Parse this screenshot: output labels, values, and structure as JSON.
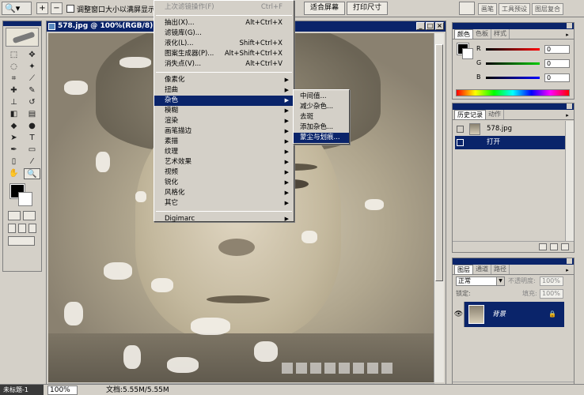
{
  "options_bar": {
    "tool_icon": "zoom-icon",
    "zoom_in": "+",
    "zoom_out": "−",
    "fit_check_label": "调整窗口大小以满屏显示",
    "fit_screen_label": "适合屏幕",
    "print_size_label": "打印尺寸",
    "tabs": [
      "画笔",
      "工具预设",
      "图层复合"
    ]
  },
  "document": {
    "title": "578.jpg @ 100%(RGB/8)",
    "min": "_",
    "max": "□",
    "close": "×"
  },
  "filter_menu": {
    "items": [
      {
        "label": "上次滤镜操作(F)",
        "shortcut": "Ctrl+F",
        "disabled": true
      },
      {
        "sep": true
      },
      {
        "label": "抽出(X)...",
        "shortcut": "Alt+Ctrl+X"
      },
      {
        "label": "滤镜库(G)..."
      },
      {
        "label": "液化(L)...",
        "shortcut": "Shift+Ctrl+X"
      },
      {
        "label": "图案生成器(P)...",
        "shortcut": "Alt+Shift+Ctrl+X"
      },
      {
        "label": "消失点(V)...",
        "shortcut": "Alt+Ctrl+V"
      },
      {
        "sep": true
      },
      {
        "label": "像素化",
        "sub": true
      },
      {
        "label": "扭曲",
        "sub": true
      },
      {
        "label": "杂色",
        "sub": true,
        "highlight": true
      },
      {
        "label": "模糊",
        "sub": true
      },
      {
        "label": "渲染",
        "sub": true
      },
      {
        "label": "画笔描边",
        "sub": true
      },
      {
        "label": "素描",
        "sub": true
      },
      {
        "label": "纹理",
        "sub": true
      },
      {
        "label": "艺术效果",
        "sub": true
      },
      {
        "label": "视频",
        "sub": true
      },
      {
        "label": "锐化",
        "sub": true
      },
      {
        "label": "风格化",
        "sub": true
      },
      {
        "label": "其它",
        "sub": true
      },
      {
        "sep": true
      },
      {
        "label": "Digimarc",
        "sub": true
      }
    ]
  },
  "noise_submenu": {
    "items": [
      {
        "label": "中间值..."
      },
      {
        "label": "减少杂色..."
      },
      {
        "label": "去斑"
      },
      {
        "label": "添加杂色..."
      },
      {
        "label": "蒙尘与划痕...",
        "highlight": true
      }
    ]
  },
  "color_palette": {
    "tabs": [
      "颜色",
      "色板",
      "样式"
    ],
    "r_label": "R",
    "g_label": "G",
    "b_label": "B",
    "r_value": "0",
    "g_value": "0",
    "b_value": "0",
    "colors": {
      "r": "#cc0000",
      "g": "#00aa00",
      "b": "#0000cc"
    }
  },
  "history_palette": {
    "tabs": [
      "历史记录",
      "动作"
    ],
    "snapshot_label": "578.jpg",
    "open_label": "打开"
  },
  "layers_palette": {
    "tabs": [
      "图层",
      "通道",
      "路径"
    ],
    "blend_mode": "正常",
    "opacity_label": "不透明度:",
    "opacity_value": "100%",
    "lock_label": "锁定:",
    "fill_label": "填充:",
    "fill_value": "100%",
    "layer_name": "背景",
    "lock_icon": "🔒"
  },
  "status_bar": {
    "zoom": "100%",
    "doc_info": "文档:5.55M/5.55M",
    "taskbar_label": "未标题-1"
  },
  "colors": {
    "title_bar": "#0a246a",
    "panel_bg": "#d4d0c8",
    "highlight": "#0a246a"
  }
}
